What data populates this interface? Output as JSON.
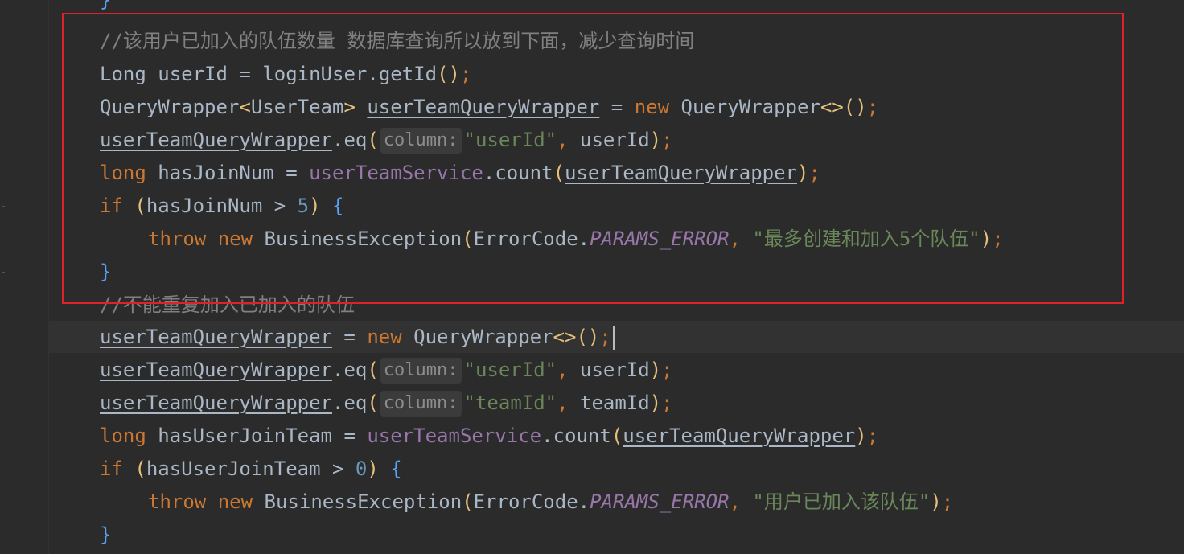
{
  "editor": {
    "tokens": {
      "cmt1": "//该用户已加入的队伍数量 数据库查询所以放到下面，减少查询时间",
      "cmt2": "//不能重复加入已加入的队伍",
      "kw_long_type": "Long",
      "kw_long": "long",
      "kw_new": "new",
      "kw_if": "if",
      "kw_throw": "throw",
      "var_userId": "userId",
      "var_loginUser": "loginUser",
      "var_getId": "getId",
      "var_wrapper": "userTeamQueryWrapper",
      "var_hasJoinNum": "hasJoinNum",
      "var_hasUserJoinTeam": "hasUserJoinTeam",
      "var_teamId": "teamId",
      "fld_service": "userTeamService",
      "cls_qw": "QueryWrapper",
      "cls_userTeam": "UserTeam",
      "cls_be": "BusinessException",
      "cls_errorCode": "ErrorCode",
      "const_params": "PARAMS_ERROR",
      "mth_eq": "eq",
      "mth_count": "count",
      "hint_column": "column:",
      "str_userId": "\"userId\"",
      "str_teamId": "\"teamId\"",
      "str_max": "\"最多创建和加入5个队伍\"",
      "str_joined": "\"用户已加入该队伍\"",
      "num_5": "5",
      "num_0": "0"
    }
  }
}
